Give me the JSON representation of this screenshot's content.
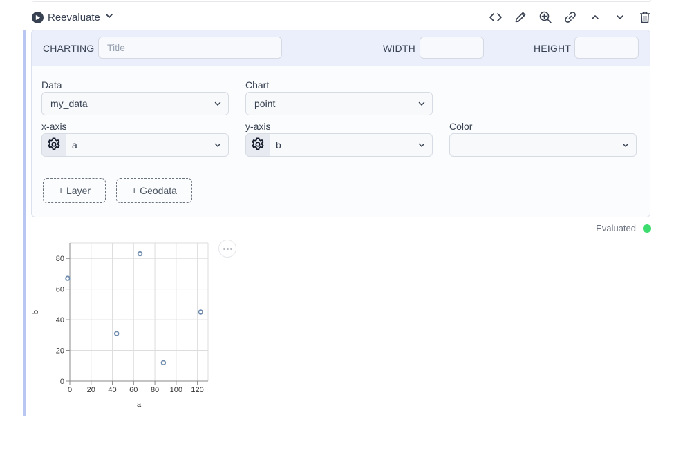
{
  "toolbar": {
    "reevaluate_label": "Reevaluate",
    "icons": [
      "code-icon",
      "pencil-icon",
      "zoom-in-icon",
      "link-icon",
      "chevron-up-icon",
      "chevron-down-icon",
      "trash-icon"
    ]
  },
  "header": {
    "charting_label": "CHARTING",
    "title_placeholder": "Title",
    "title_value": "",
    "width_label": "WIDTH",
    "width_value": "",
    "height_label": "HEIGHT",
    "height_value": ""
  },
  "fields": {
    "data_label": "Data",
    "data_value": "my_data",
    "chart_label": "Chart",
    "chart_value": "point",
    "xaxis_label": "x-axis",
    "xaxis_value": "a",
    "yaxis_label": "y-axis",
    "yaxis_value": "b",
    "color_label": "Color",
    "color_value": ""
  },
  "buttons": {
    "layer_label": "+ Layer",
    "geodata_label": "+ Geodata"
  },
  "status": {
    "text": "Evaluated",
    "color": "#3ddc6e"
  },
  "colors": {
    "accent": "#b9c6f2",
    "header_bg": "#ebeffc",
    "point_stroke": "#6e8bad"
  },
  "chart_data": {
    "type": "scatter",
    "xlabel": "a",
    "ylabel": "b",
    "xlim": [
      0,
      130
    ],
    "ylim": [
      0,
      90
    ],
    "xticks": [
      0,
      20,
      40,
      60,
      80,
      100,
      120
    ],
    "yticks": [
      0,
      20,
      40,
      60,
      80
    ],
    "grid": true,
    "points": [
      {
        "x": -2,
        "y": 67
      },
      {
        "x": 44,
        "y": 31
      },
      {
        "x": 66,
        "y": 83
      },
      {
        "x": 88,
        "y": 12
      },
      {
        "x": 123,
        "y": 45
      }
    ]
  }
}
